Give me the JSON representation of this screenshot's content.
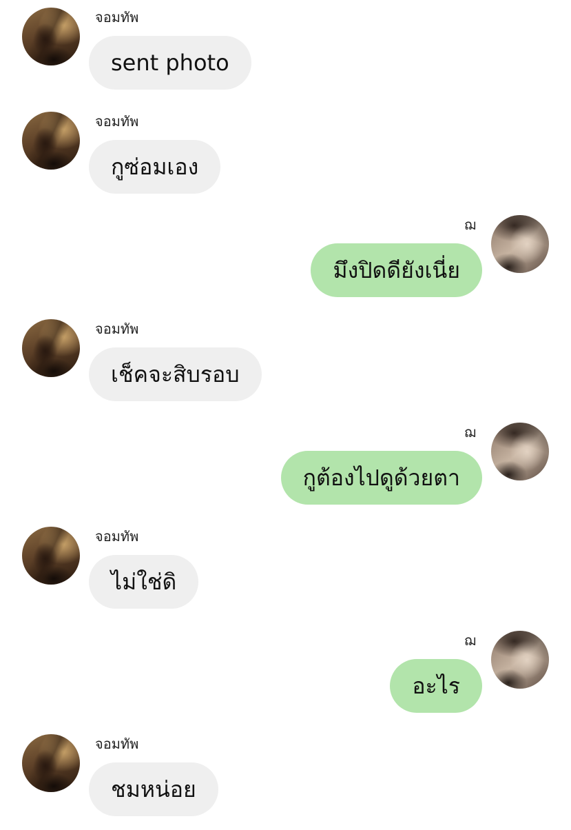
{
  "colors": {
    "incoming_bubble": "#efefef",
    "outgoing_bubble": "#b2e4ab",
    "background": "#ffffff"
  },
  "icons": {
    "incoming_avatar": "avatar-photo",
    "outgoing_avatar": "avatar-photo"
  },
  "messages": [
    {
      "side": "in",
      "sender": "จอมทัพ",
      "text": "sent photo"
    },
    {
      "side": "in",
      "sender": "จอมทัพ",
      "text": "กูซ่อมเอง"
    },
    {
      "side": "out",
      "sender": "ฌ",
      "text": "มึงปิดดียังเนี่ย"
    },
    {
      "side": "in",
      "sender": "จอมทัพ",
      "text": "เช็คจะสิบรอบ"
    },
    {
      "side": "out",
      "sender": "ฌ",
      "text": "กูต้องไปดูด้วยตา"
    },
    {
      "side": "in",
      "sender": "จอมทัพ",
      "text": "ไม่ใช่ดิ"
    },
    {
      "side": "out",
      "sender": "ฌ",
      "text": "อะไร"
    },
    {
      "side": "in",
      "sender": "จอมทัพ",
      "text": "ชมหน่อย"
    }
  ]
}
